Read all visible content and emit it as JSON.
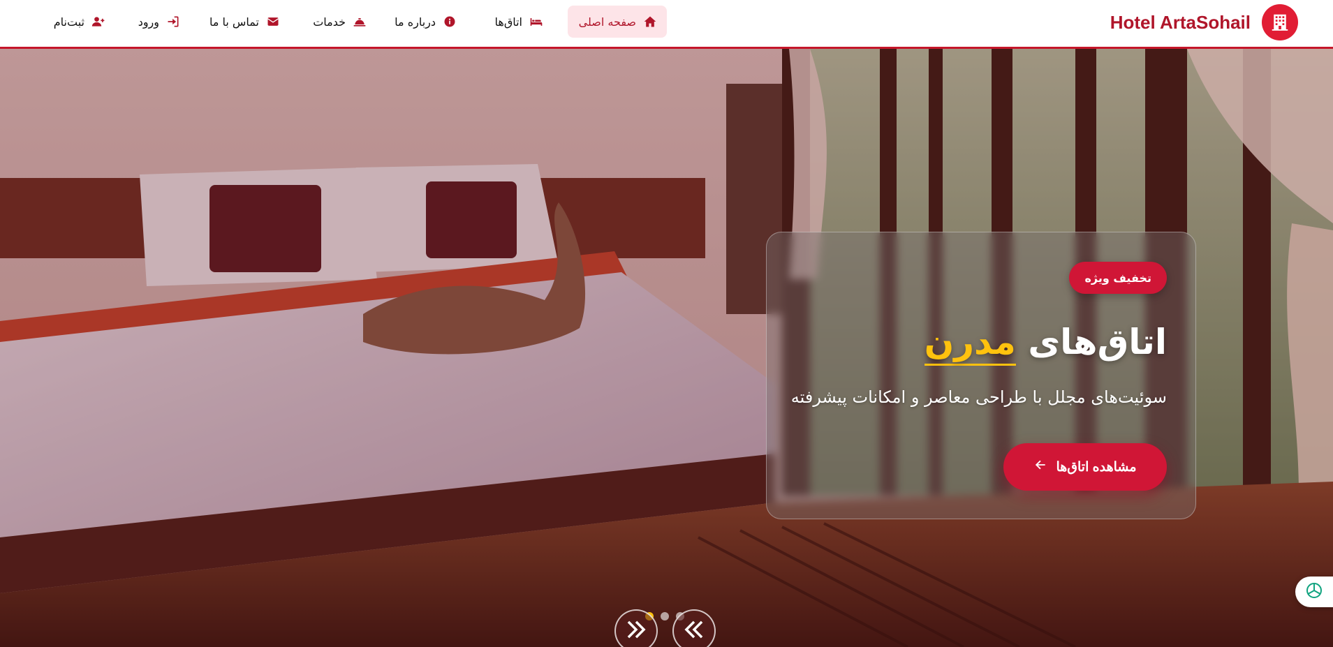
{
  "brand": {
    "name": "Hotel ArtaSohail",
    "icon": "hotel-building-icon"
  },
  "nav": {
    "items": [
      {
        "label": "صفحه اصلی",
        "icon": "home-icon",
        "active": true
      },
      {
        "label": "اتاق‌ها",
        "icon": "bed-icon",
        "active": false
      },
      {
        "label": "درباره ما",
        "icon": "info-circle-icon",
        "active": false
      },
      {
        "label": "خدمات",
        "icon": "concierge-bell-icon",
        "active": false
      },
      {
        "label": "تماس با ما",
        "icon": "envelope-icon",
        "active": false
      },
      {
        "label": "ورود",
        "icon": "sign-in-icon",
        "active": false
      },
      {
        "label": "ثبت‌نام",
        "icon": "user-plus-icon",
        "active": false
      }
    ]
  },
  "hero": {
    "badge": "تخفیف ویژه",
    "title_main": "اتاق‌های",
    "title_highlight": "مدرن",
    "subtitle": "سوئیت‌های مجلل با طراحی معاصر و امکانات پیشرفته",
    "cta_label": "مشاهده اتاق‌ها",
    "cta_icon": "arrow-left-icon",
    "slide_count": 3,
    "active_slide": 1
  },
  "colors": {
    "brand": "#b0152a",
    "accent": "#d01636",
    "highlight": "#ffc20e",
    "nav_active_bg": "#fde4e8"
  },
  "chat_widget": {
    "icon": "chatgpt-logo-icon"
  }
}
